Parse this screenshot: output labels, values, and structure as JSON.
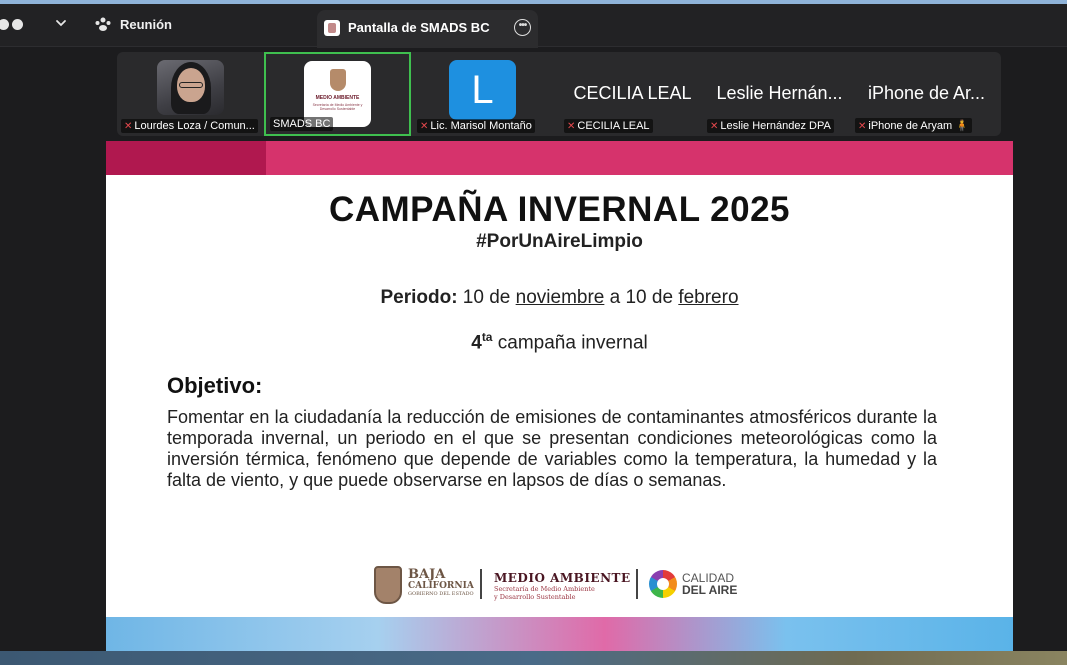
{
  "titlebar": {
    "meeting_label": "Reunión",
    "share_tab_label": "Pantalla de SMADS BC"
  },
  "participants": [
    {
      "name": "Lourdes Loza / Comun...",
      "type": "photo",
      "muted": true
    },
    {
      "name": "SMADS BC",
      "type": "logo",
      "muted": false,
      "active": true,
      "logo_title": "MEDIO AMBIENTE",
      "logo_subtitle": "Secretaría de Medio Ambiente y Desarrollo Sustentable"
    },
    {
      "name": "Lic. Marisol Montaño",
      "type": "avatar",
      "initial": "L",
      "muted": true
    },
    {
      "name": "CECILIA LEAL",
      "display": "CECILIA LEAL",
      "type": "text",
      "muted": true
    },
    {
      "name": "Leslie Hernández DPA",
      "display": "Leslie Hernán...",
      "type": "text",
      "muted": true
    },
    {
      "name": "iPhone de Aryam",
      "display": "iPhone de Ar...",
      "type": "text",
      "muted": true,
      "emoji": "🧍"
    }
  ],
  "slide": {
    "title": "CAMPAÑA INVERNAL 2025",
    "hashtag": "#PorUnAireLimpio",
    "period_label": "Periodo:",
    "period_part1": " 10 de ",
    "period_month1": "noviembre",
    "period_part2": " a 10 de ",
    "period_month2": "febrero",
    "edition_number": "4",
    "edition_suffix": "ta",
    "edition_text": " campaña invernal",
    "objective_heading": "Objetivo:",
    "objective_body": "Fomentar en la ciudadanía la reducción de emisiones de contaminantes atmosféricos durante la temporada invernal, un periodo en el que se presentan condiciones meteorológicas como la inversión térmica, fenómeno que depende de variables como la temperatura, la humedad y la falta de viento, y que puede observarse en lapsos de días o semanas.",
    "footer": {
      "bc_line1": "BAJA",
      "bc_line2": "CALIFORNIA",
      "bc_line3": "GOBIERNO DEL ESTADO",
      "ma_line1": "MEDIO AMBIENTE",
      "ma_line2": "Secretaría de Medio Ambiente",
      "ma_line3": "y Desarrollo Sustentable",
      "ca_line1": "CALIDAD",
      "ca_line2": "DEL AIRE"
    }
  },
  "colors": {
    "accent_pink": "#d6336c",
    "active_speaker": "#3fbf4f",
    "avatar_blue": "#1e90e0"
  }
}
